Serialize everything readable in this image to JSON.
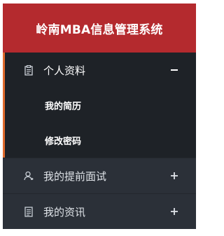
{
  "app": {
    "title": "岭南MBA信息管理系统"
  },
  "menu": {
    "groups": [
      {
        "label": "个人资料",
        "icon": "clipboard-icon",
        "toggle": "minus",
        "expanded": true,
        "items": [
          {
            "label": "我的简历"
          },
          {
            "label": "修改密码"
          }
        ]
      },
      {
        "label": "我的提前面试",
        "icon": "user-icon",
        "toggle": "plus",
        "expanded": false
      },
      {
        "label": "我的资讯",
        "icon": "document-icon",
        "toggle": "plus",
        "expanded": false
      }
    ]
  },
  "colors": {
    "header_bg": "#b42a2e",
    "menu_bg": "#2a2f36",
    "active_bg": "#1e2227",
    "accent": "#e06a2c",
    "text": "#ffffff"
  }
}
